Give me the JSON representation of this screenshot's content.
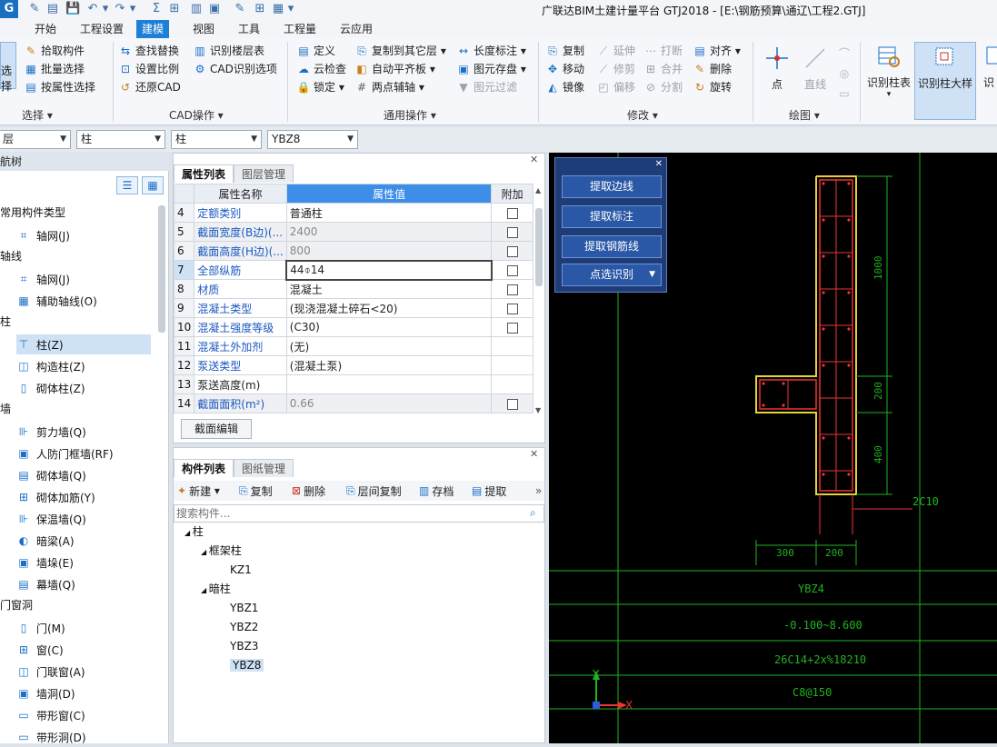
{
  "window": {
    "logo": "G",
    "title": "广联达BIM土建计量平台 GTJ2018 - [E:\\钢筋预算\\通辽\\工程2.GTJ]",
    "quick_access": [
      "✎",
      "▤",
      "💾",
      "↶",
      "▾",
      "↷",
      "▾",
      "Σ",
      "⊞",
      "▥",
      "▣",
      "✎",
      "⊞",
      "▦",
      "▾"
    ]
  },
  "menu": [
    "开始",
    "工程设置",
    "建模",
    "视图",
    "工具",
    "工程量",
    "云应用"
  ],
  "menu_active_index": 2,
  "ribbon": {
    "select_group": {
      "big_label": "选择",
      "label": "选择"
    },
    "tools_group": {
      "items": [
        "拾取构件",
        "批量选择",
        "按属性选择"
      ]
    },
    "cad_group": {
      "label": "CAD操作",
      "items": [
        "查找替换",
        "设置比例",
        "还原CAD",
        "识别楼层表",
        "CAD识别选项"
      ]
    },
    "common_group": {
      "label": "通用操作",
      "items": [
        "定义",
        "云检查",
        "锁定",
        "复制到其它层",
        "自动平齐板",
        "两点辅轴",
        "长度标注",
        "图元存盘",
        "图元过滤"
      ]
    },
    "modify_group": {
      "label": "修改",
      "items": [
        "复制",
        "移动",
        "镜像",
        "延伸",
        "修剪",
        "偏移",
        "打断",
        "合并",
        "分割",
        "对齐",
        "删除",
        "旋转"
      ]
    },
    "draw_group": {
      "label": "绘图",
      "items": [
        "点",
        "直线"
      ]
    },
    "recog_group": {
      "items": [
        "识别柱表",
        "识别柱大样",
        "识"
      ]
    }
  },
  "filters": {
    "floor": "层",
    "type": "柱",
    "subtype": "柱",
    "component": "YBZ8"
  },
  "nav": {
    "title": "航树",
    "tree": [
      {
        "cat": "常用构件类型",
        "items": [
          {
            "icon": "⌗",
            "label": "轴网(J)"
          }
        ]
      },
      {
        "cat": "轴线",
        "items": [
          {
            "icon": "⌗",
            "label": "轴网(J)"
          },
          {
            "icon": "▦",
            "label": "辅助轴线(O)"
          }
        ]
      },
      {
        "cat": "柱",
        "items": [
          {
            "icon": "⊤",
            "label": "柱(Z)",
            "selected": true
          },
          {
            "icon": "◫",
            "label": "构造柱(Z)"
          },
          {
            "icon": "▯",
            "label": "砌体柱(Z)"
          }
        ]
      },
      {
        "cat": "墙",
        "items": [
          {
            "icon": "⊪",
            "label": "剪力墙(Q)"
          },
          {
            "icon": "▣",
            "label": "人防门框墙(RF)"
          },
          {
            "icon": "▤",
            "label": "砌体墙(Q)"
          },
          {
            "icon": "⊞",
            "label": "砌体加筋(Y)"
          },
          {
            "icon": "⊪",
            "label": "保温墙(Q)"
          },
          {
            "icon": "◐",
            "label": "暗梁(A)"
          },
          {
            "icon": "▣",
            "label": "墙垛(E)"
          },
          {
            "icon": "▤",
            "label": "幕墙(Q)"
          }
        ]
      },
      {
        "cat": "门窗洞",
        "items": [
          {
            "icon": "▯",
            "label": "门(M)"
          },
          {
            "icon": "⊞",
            "label": "窗(C)"
          },
          {
            "icon": "◫",
            "label": "门联窗(A)"
          },
          {
            "icon": "▣",
            "label": "墙洞(D)"
          },
          {
            "icon": "▭",
            "label": "带形窗(C)"
          },
          {
            "icon": "▭",
            "label": "带形洞(D)"
          }
        ]
      }
    ]
  },
  "properties": {
    "tabs": [
      "属性列表",
      "图层管理"
    ],
    "headers": [
      "属性名称",
      "属性值",
      "附加"
    ],
    "rows": [
      {
        "n": "4",
        "name": "定额类别",
        "value": "普通柱",
        "blue": true,
        "check": true,
        "grey": false
      },
      {
        "n": "5",
        "name": "截面宽度(B边)(...",
        "value": "2400",
        "blue": true,
        "check": true,
        "grey": true
      },
      {
        "n": "6",
        "name": "截面高度(H边)(...",
        "value": "800",
        "blue": true,
        "check": true,
        "grey": true
      },
      {
        "n": "7",
        "name": "全部纵筋",
        "value": "44⌽14",
        "blue": true,
        "check": true,
        "grey": false,
        "sel": true
      },
      {
        "n": "8",
        "name": "材质",
        "value": "混凝土",
        "blue": true,
        "check": true,
        "grey": false
      },
      {
        "n": "9",
        "name": "混凝土类型",
        "value": "(现浇混凝土碎石<20)",
        "blue": true,
        "check": true,
        "grey": false
      },
      {
        "n": "10",
        "name": "混凝土强度等级",
        "value": "(C30)",
        "blue": true,
        "check": true,
        "grey": false
      },
      {
        "n": "11",
        "name": "混凝土外加剂",
        "value": "(无)",
        "blue": true,
        "check": false,
        "grey": false
      },
      {
        "n": "12",
        "name": "泵送类型",
        "value": "(混凝土泵)",
        "blue": true,
        "check": false,
        "grey": false
      },
      {
        "n": "13",
        "name": "泵送高度(m)",
        "value": "",
        "blue": false,
        "check": false,
        "grey": false
      },
      {
        "n": "14",
        "name": "截面面积(m²)",
        "value": "0.66",
        "blue": true,
        "check": true,
        "grey": true
      }
    ],
    "section_edit": "截面编辑"
  },
  "components": {
    "tabs": [
      "构件列表",
      "图纸管理"
    ],
    "toolbar": [
      "新建",
      "复制",
      "删除",
      "层间复制",
      "存档",
      "提取"
    ],
    "search_placeholder": "搜索构件...",
    "tree": {
      "root": "柱",
      "groups": [
        {
          "name": "框架柱",
          "items": [
            "KZ1"
          ]
        },
        {
          "name": "暗柱",
          "items": [
            "YBZ1",
            "YBZ2",
            "YBZ3",
            "YBZ8"
          ]
        }
      ],
      "selected": "YBZ8"
    }
  },
  "float_panel": {
    "buttons": [
      "提取边线",
      "提取标注",
      "提取钢筋线",
      "点选识别"
    ]
  },
  "cad": {
    "dims": [
      "1000",
      "200",
      "400",
      "300",
      "200"
    ],
    "leader": "2C10",
    "table": [
      "YBZ4",
      "-0.100~8.600",
      "26C14+2x%18210",
      "C8@150"
    ],
    "axis_x": "X",
    "axis_y": "Y"
  }
}
